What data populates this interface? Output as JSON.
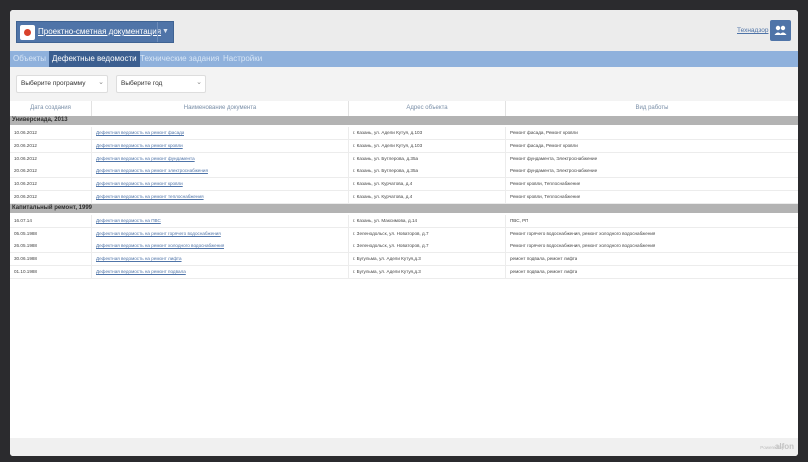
{
  "app": {
    "title": "Проектно-сметная документация",
    "user": "Технадзор"
  },
  "tabs": [
    "Объекты",
    "Дефектные ведомости",
    "Технические задания",
    "Настройки"
  ],
  "filters": {
    "program": "Выберите программу",
    "year": "Выберите год"
  },
  "columns": [
    "Дата создания",
    "Наименование документа",
    "Адрес объекта",
    "Вид работы"
  ],
  "groups": [
    {
      "title": "Универсиада, 2013",
      "rows": [
        [
          "10.06.2012",
          "Дефектная ведомость на ремонт фасада",
          "г. Казань, ул. Адели Кутуя, д.103",
          "Ремонт фасада, Ремонт кровли"
        ],
        [
          "20.06.2012",
          "Дефектная ведомость на ремонт кровли",
          "г. Казань, ул. Адели Кутуя, д.103",
          "Ремонт фасада, Ремонт кровли"
        ],
        [
          "10.06.2012",
          "Дефектная ведомость на ремонт фундамента",
          "г. Казань, ул. Бутлерова, д.35а",
          "Ремонт фундамента, Электроснабжение"
        ],
        [
          "20.06.2012",
          "Дефектная ведомость на ремонт электроснабжения",
          "г. Казань, ул. Бутлерова, д.35а",
          "Ремонт фундамента, Электроснабжение"
        ],
        [
          "10.06.2012",
          "Дефектная ведомость на ремонт кровли",
          "г. Казань, ул. Курчатова, д.4",
          "Ремонт кровли, Теплоснабжение"
        ],
        [
          "20.06.2012",
          "Дефектная ведомость на ремонт теплоснабжения",
          "г. Казань, ул. Курчатова, д.4",
          "Ремонт кровли, Теплоснабжение"
        ]
      ]
    },
    {
      "title": "Капитальный ремонт, 1999",
      "rows": [
        [
          "16.07.14",
          "Дефектная ведомость на ПВС",
          "г. Казань, ул. Максимова, д.14",
          "ПВС, РП"
        ],
        [
          "05.05.1988",
          "Дефектная ведомость на ремонт горячего водоснабжения",
          "г. Зеленодольск, ул. Новаторов, д.7",
          "Ремонт горячего водоснабжения, ремонт холодного водоснабжения"
        ],
        [
          "26.05.1988",
          "Дефектная ведомость на ремонт холодного водоснабжения",
          "г. Зеленодольск, ул. Новаторов, д.7",
          "Ремонт горячего водоснабжения, ремонт холодного водоснабжения"
        ],
        [
          "30.06.1988",
          "Дефектная ведомость на ремонт лифта",
          "г. Бугульма, ул. Адели Кутуя,д.3",
          "ремонт подвала, ремонт лифта"
        ],
        [
          "01.10.1988",
          "Дефектная ведомость на ремонт подвала",
          "г. Бугульма, ул. Адели Кутуя,д.3",
          "ремонт подвала, ремонт лифта"
        ]
      ]
    }
  ],
  "footer": {
    "powered": "Powered by",
    "brand": "alfon"
  },
  "colors": {
    "accent": "#4f74a8",
    "tabbar": "#8fb1dc",
    "tab_active": "#3c5f90",
    "group": "#b3b3b3"
  }
}
